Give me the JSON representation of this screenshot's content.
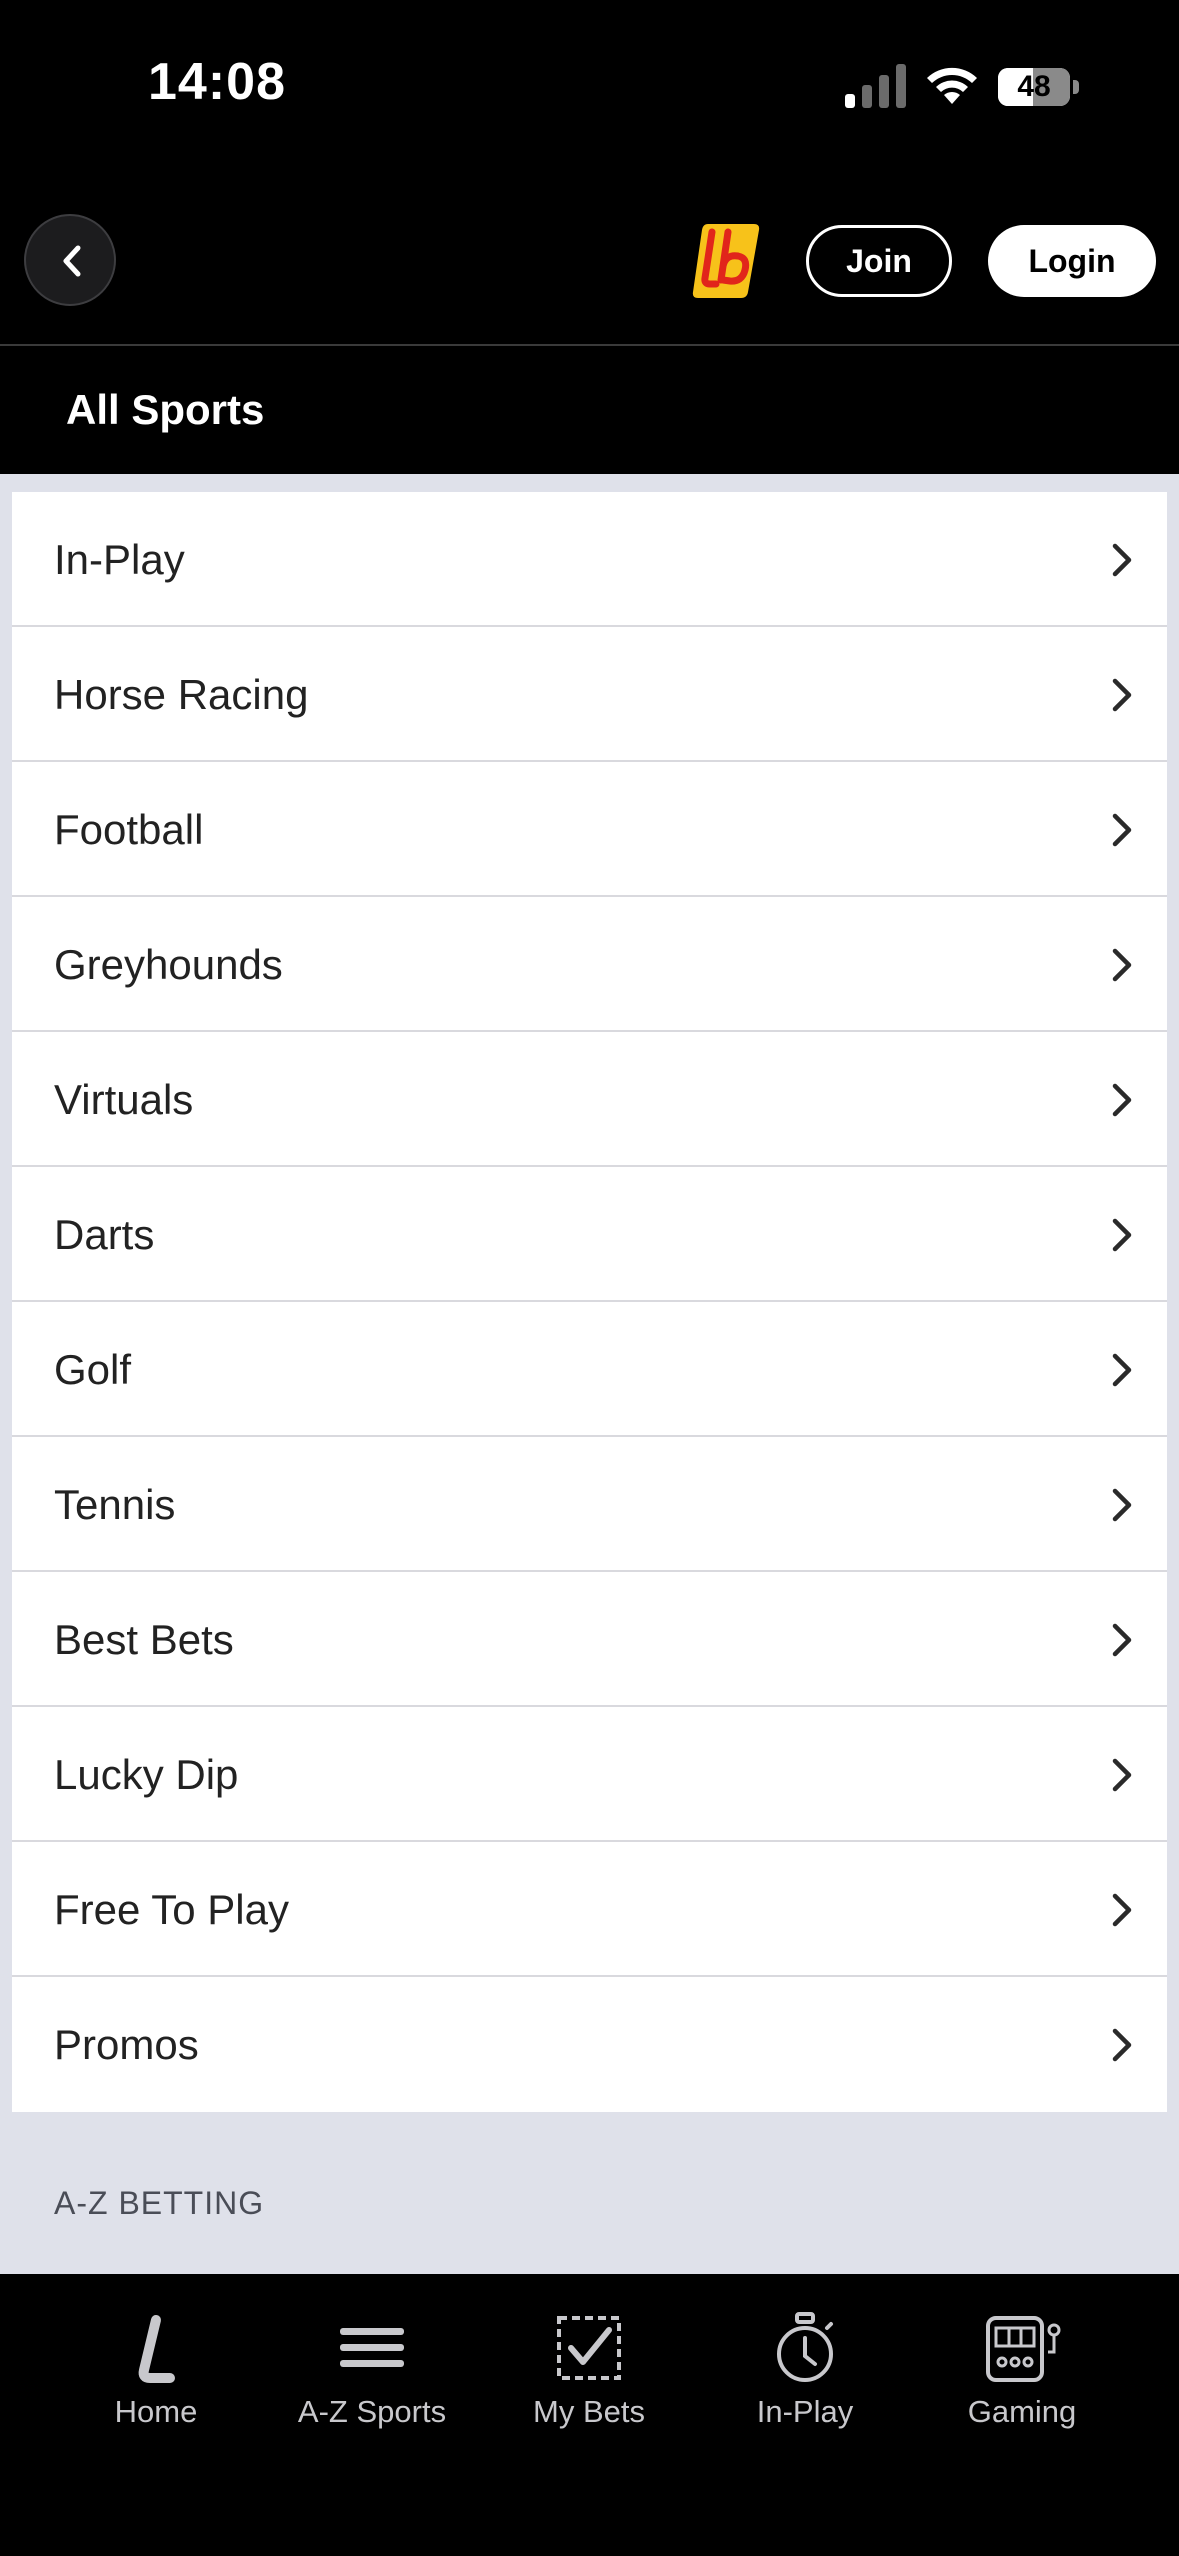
{
  "status_bar": {
    "time": "14:08",
    "battery_level": "48",
    "icons": [
      "signal-icon",
      "wifi-icon",
      "battery-icon"
    ]
  },
  "header": {
    "back_icon": "chevron-left-icon",
    "logo": "lb-logo",
    "join_label": "Join",
    "login_label": "Login"
  },
  "page": {
    "title": "All Sports"
  },
  "menu": {
    "items": [
      {
        "label": "In-Play"
      },
      {
        "label": "Horse Racing"
      },
      {
        "label": "Football"
      },
      {
        "label": "Greyhounds"
      },
      {
        "label": "Virtuals"
      },
      {
        "label": "Darts"
      },
      {
        "label": "Golf"
      },
      {
        "label": "Tennis"
      },
      {
        "label": "Best Bets"
      },
      {
        "label": "Lucky Dip"
      },
      {
        "label": "Free To Play"
      },
      {
        "label": "Promos"
      }
    ],
    "chevron_icon": "chevron-right-icon"
  },
  "az_section": {
    "heading": "A-Z BETTING"
  },
  "tab_bar": {
    "tabs": [
      {
        "label": "Home",
        "icon": "home-logo-icon"
      },
      {
        "label": "A-Z Sports",
        "icon": "menu-icon"
      },
      {
        "label": "My Bets",
        "icon": "bet-slip-icon"
      },
      {
        "label": "In-Play",
        "icon": "stopwatch-icon"
      },
      {
        "label": "Gaming",
        "icon": "slot-machine-icon"
      }
    ]
  },
  "colors": {
    "background": "#dfe1ea",
    "header": "#000000",
    "logo_yellow": "#f7c21a",
    "logo_red": "#e1251b"
  }
}
